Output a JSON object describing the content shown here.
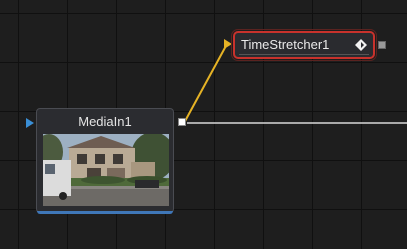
{
  "nodes": {
    "mediain": {
      "label": "MediaIn1"
    },
    "timestretcher": {
      "label": "TimeStretcher1"
    }
  },
  "colors": {
    "link_selected": "#e6b325",
    "link_normal": "#d9d9d9",
    "input_port": "#3a8fd6",
    "timestretcher_input_port": "#e6b325",
    "selection_border": "#c8322c",
    "media_underline": "#3f77b8"
  },
  "icons": {
    "keyframe": "diamond-keyframe-icon",
    "output_port": "square-output-port"
  }
}
